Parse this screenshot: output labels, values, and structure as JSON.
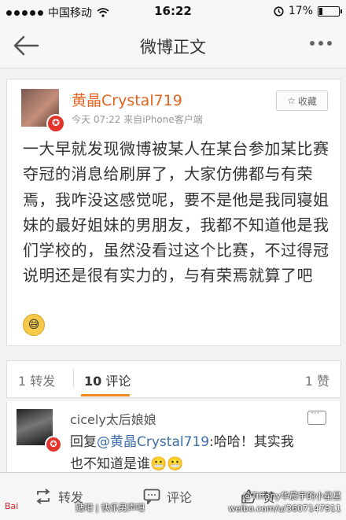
{
  "status_bar": {
    "carrier": "中国移动",
    "time": "16:22",
    "battery": "17%",
    "battery_level": 0.17
  },
  "nav": {
    "title": "微博正文"
  },
  "post": {
    "username": "黄晶Crystal719",
    "time": "今天 07:22",
    "source": "来自iPhone客户端",
    "favorite_label": "收藏",
    "text": "一大早就发现微博被某人在某台参加某比赛夺冠的消息给刷屏了，大家仿佛都与有荣焉，我咋没这感觉呢，要不是他是我同寝姐妹的最好姐妹的男朋友，我都不知道他是我们学校的，虽然没看过这个比赛，不过得冠说明还是很有实力的，与有荣焉就算了吧"
  },
  "tabs": {
    "repost_count": "1",
    "repost_label": "转发",
    "comment_count": "10",
    "comment_label": "评论",
    "like_count": "1",
    "like_label": "赞"
  },
  "comment": {
    "name": "cicely太后娘娘",
    "reply_prefix": "回复",
    "mention": "@黄晶Crystal719",
    "text": ":哈哈！其实我也不知道是谁"
  },
  "toolbar": {
    "repost": "转发",
    "comment": "评论",
    "like": "赞"
  },
  "watermarks": {
    "left_a": "Bai",
    "left_b": "贴吧 | 快乐男声吧",
    "right_1": "@Tiffany华晨宇的小星星",
    "right_2": "weibo.com/u/3607147911"
  }
}
